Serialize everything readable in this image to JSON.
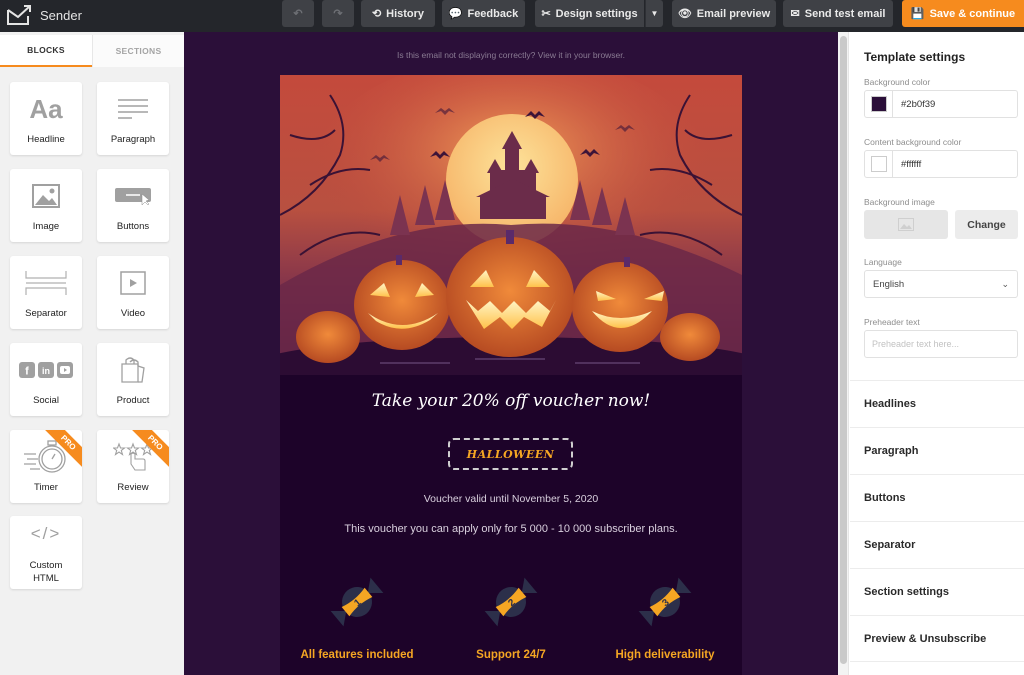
{
  "topbar": {
    "brand": "Sender",
    "undo_icon": "undo-icon",
    "redo_icon": "redo-icon",
    "history_label": "History",
    "history_icon": "history-icon",
    "feedback_label": "Feedback",
    "feedback_icon": "chat-bubbles-icon",
    "design_settings_label": "Design settings",
    "design_settings_icon": "tools-icon",
    "design_dropdown_icon": "caret-down-icon",
    "email_preview_label": "Email preview",
    "email_preview_icon": "eye-icon",
    "send_test_label": "Send test email",
    "send_test_icon": "envelope-open-icon",
    "save_label": "Save & continue",
    "save_icon": "floppy-disk-icon",
    "accent_color": "#f68b1e"
  },
  "left_panel": {
    "tabs": [
      {
        "label": "BLOCKS",
        "active": true
      },
      {
        "label": "SECTIONS",
        "active": false
      }
    ],
    "blocks": [
      {
        "label": "Headline",
        "icon": "text-aa-icon"
      },
      {
        "label": "Paragraph",
        "icon": "paragraph-lines-icon"
      },
      {
        "label": "Image",
        "icon": "image-icon"
      },
      {
        "label": "Buttons",
        "icon": "button-cursor-icon"
      },
      {
        "label": "Separator",
        "icon": "separator-icon"
      },
      {
        "label": "Video",
        "icon": "video-play-icon"
      },
      {
        "label": "Social",
        "icon": "social-icons-icon"
      },
      {
        "label": "Product",
        "icon": "shopping-bag-icon"
      },
      {
        "label": "Timer",
        "icon": "stopwatch-icon",
        "badge": "PRO"
      },
      {
        "label": "Review",
        "icon": "stars-hand-icon",
        "badge": "PRO"
      },
      {
        "label": "Custom HTML",
        "icon": "code-brackets-icon"
      }
    ]
  },
  "canvas": {
    "background_color": "#2b0f39",
    "browser_notice": "Is this email not displaying correctly? View it in your browser.",
    "hero_image": "halloween-pumpkins-illustration",
    "headline": "Take your 20% off voucher now!",
    "voucher_code": "HALLOWEEN",
    "valid_until": "Voucher valid until November 5, 2020",
    "apply_note": "This voucher you can apply only for 5 000 - 10 000 subscriber plans.",
    "features": [
      {
        "number": "1",
        "label": "All features included",
        "icon": "candy-icon"
      },
      {
        "number": "2",
        "label": "Support 24/7",
        "icon": "candy-icon"
      },
      {
        "number": "3",
        "label": "High deliverability",
        "icon": "candy-icon"
      }
    ]
  },
  "right_panel": {
    "title": "Template settings",
    "background_color_label": "Background color",
    "background_color_value": "#2b0f39",
    "content_bg_label": "Content background color",
    "content_bg_value": "#ffffff",
    "background_image_label": "Background image",
    "change_label": "Change",
    "language_label": "Language",
    "language_value": "English",
    "preheader_label": "Preheader text",
    "preheader_placeholder": "Preheader text here...",
    "sections": [
      "Headlines",
      "Paragraph",
      "Buttons",
      "Separator",
      "Section settings",
      "Preview & Unsubscribe"
    ]
  }
}
